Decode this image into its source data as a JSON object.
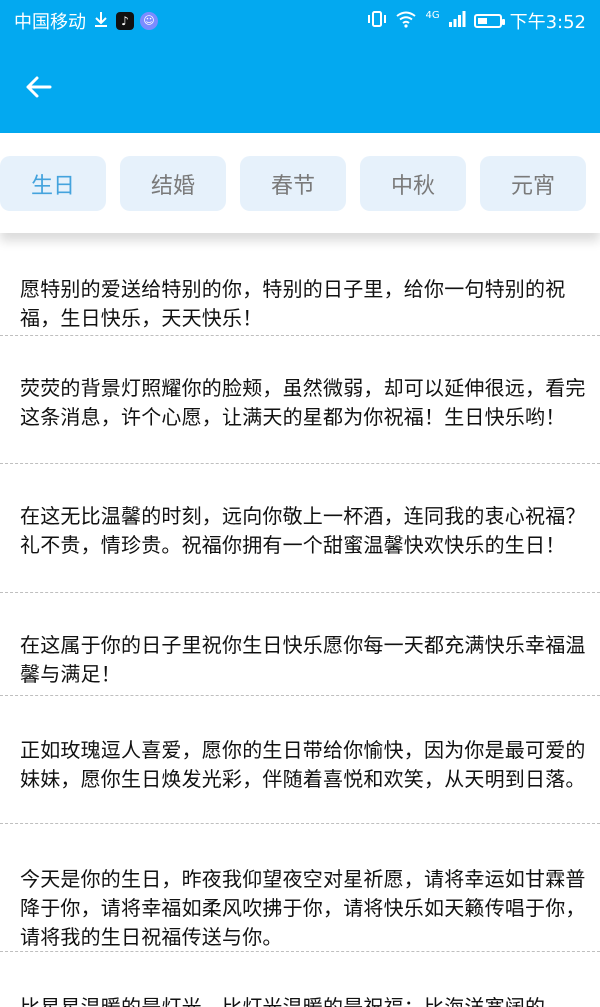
{
  "status_bar": {
    "carrier": "中国移动",
    "network": "4G",
    "time": "下午3:52",
    "battery_level": 0.45
  },
  "colors": {
    "accent": "#03a9f0",
    "tab_bg": "#e6f1fb",
    "tab_active_text": "#44a3dd"
  },
  "header": {
    "back_icon": "arrow-left-icon"
  },
  "tabs": [
    {
      "label": "生日",
      "active": true
    },
    {
      "label": "结婚",
      "active": false
    },
    {
      "label": "春节",
      "active": false
    },
    {
      "label": "中秋",
      "active": false
    },
    {
      "label": "元宵",
      "active": false
    }
  ],
  "messages": [
    "愿特别的爱送给特别的你，特别的日子里，给你一句特别的祝福，生日快乐，天天快乐！",
    "荧荧的背景灯照耀你的脸颊，虽然微弱，却可以延伸很远，看完这条消息，许个心愿，让满天的星都为你祝福！生日快乐哟！",
    "在这无比温馨的时刻，远向你敬上一杯酒，连同我的衷心祝福？礼不贵，情珍贵。祝福你拥有一个甜蜜温馨快欢快乐的生日！",
    "在这属于你的日子里祝你生日快乐愿你每一天都充满快乐幸福温馨与满足！",
    "正如玫瑰逗人喜爱，愿你的生日带给你愉快，因为你是最可爱的妹妹，愿你生日焕发光彩，伴随着喜悦和欢笑，从天明到日落。",
    "今天是你的生日，昨夜我仰望夜空对星祈愿，请将幸运如甘霖普降于你，请将幸福如柔风吹拂于你，请将快乐如天籁传唱于你，请将我的生日祝福传送与你。",
    "比星星温暖的是灯光，比灯光温暖的是祝福；比海洋宽阔的"
  ]
}
